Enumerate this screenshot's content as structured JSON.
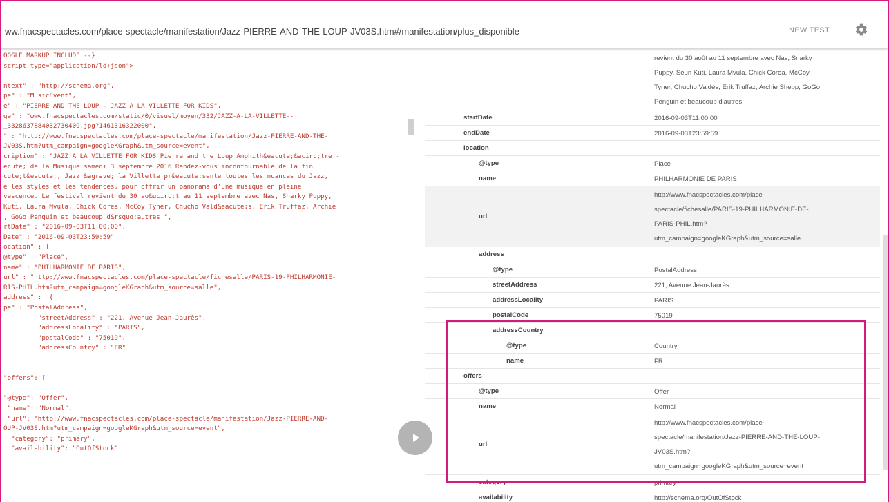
{
  "header": {
    "url": "ww.fnacspectacles.com/place-spectacle/manifestation/Jazz-PIERRE-AND-THE-LOUP-JV03S.htm#/manifestation/plus_disponible",
    "new_test_label": "NEW TEST",
    "settings_icon": "gear-icon"
  },
  "code_lines": [
    "OOGLE MARKUP INCLUDE --}",
    "script type=\"application/ld+json\">",
    "",
    "ntext\" : \"http://schema.org\",",
    "pe\" : \"MusicEvent\",",
    "e\" : \"PIERRE AND THE LOUP - JAZZ A LA VILLETTE FOR KIDS\",",
    "ge\" : \"www.fnacspectacles.com/static/0/visuel/moyen/332/JAZZ-A-LA-VILLETTE--",
    "_3328637884032730409.jpg?1461316322000\",",
    "\" : \"http://www.fnacspectacles.com/place-spectacle/manifestation/Jazz-PIERRE-AND-THE-",
    "JV03S.htm?utm_campaign=googleKGraph&utm_source=event\",",
    "cription\" : \"JAZZ A LA VILLETTE FOR KIDS Pierre and the Loup Amphith&eacute;&acirc;tre -",
    "ecute; de la Musique samedi 3 septembre 2016 Rendez-vous incontournable de la fin",
    "cute;t&eacute;, Jazz &agrave; la Villette pr&eacute;sente toutes les nuances du Jazz,",
    "e les styles et les tendences, pour offrir un panorama d'une musique en pleine",
    "vescence. Le festival revient du 30 ao&ucirc;t au 11 septembre avec Nas, Snarky Puppy,",
    "Kuti, Laura Mvula, Chick Corea, McCoy Tyner, Chucho Vald&eacute;s, Erik Truffaz, Archie",
    ", GoGo Penguin et beaucoup d&rsquo;autres.\",",
    "rtDate\" : \"2016-09-03T11:00:00\",",
    "Date\" : \"2016-09-03T23:59:59\"",
    "ocation\" : {",
    "@type\" : \"Place\",",
    "name\" : \"PHILHARMONIE DE PARIS\",",
    "url\" : \"http://www.fnacspectacles.com/place-spectacle/fichesalle/PARIS-19-PHILHARMONIE-",
    "RIS-PHIL.htm?utm_campaign=googleKGraph&utm_source=salle\",",
    "address\" :  {",
    "pe\" : \"PostalAddress\",",
    "         \"streetAddress\" : \"221, Avenue Jean-Jaurès\",",
    "         \"addressLocality\" : \"PARIS\",",
    "         \"postalCode\" : \"75019\",",
    "         \"addressCountry\" : \"FR\"",
    "",
    "",
    "\"offers\": [",
    "",
    "\"@type\": \"Offer\",",
    " \"name\": \"Normal\",",
    " \"url\": \"http://www.fnacspectacles.com/place-spectacle/manifestation/Jazz-PIERRE-AND-",
    "OUP-JV03S.htm?utm_campaign=googleKGraph&utm_source=event\",",
    "  \"category\": \"primary\",",
    "  \"availability\": \"OutOfStock\""
  ],
  "result_rows": [
    {
      "key": "",
      "value": [
        "revient du 30 août au 11 septembre avec Nas, Snarky",
        "Puppy, Seun Kuti, Laura Mvula, Chick Corea, McCoy",
        "Tyner, Chucho Valdés, Erik Truffaz, Archie Shepp, GoGo",
        "Penguin et beaucoup d'autres."
      ]
    },
    {
      "key": "startDate",
      "value": [
        "2016-09-03T11:00:00"
      ]
    },
    {
      "key": "endDate",
      "value": [
        "2016-09-03T23:59:59"
      ]
    },
    {
      "key": "location",
      "value": []
    },
    {
      "key": "@type",
      "value": [
        "Place"
      ]
    },
    {
      "key": "name",
      "value": [
        "PHILHARMONIE DE PARIS"
      ]
    },
    {
      "key": "url",
      "value": [
        "http://www.fnacspectacles.com/place-",
        "spectacle/fichesalle/PARIS-19-PHILHARMONIE-DE-",
        "PARIS-PHIL.htm?",
        "utm_campaign=googleKGraph&utm_source=salle"
      ]
    },
    {
      "key": "address",
      "value": []
    },
    {
      "key": "@type",
      "value": [
        "PostalAddress"
      ]
    },
    {
      "key": "streetAddress",
      "value": [
        "221, Avenue Jean-Jaurès"
      ]
    },
    {
      "key": "addressLocality",
      "value": [
        "PARIS"
      ]
    },
    {
      "key": "postalCode",
      "value": [
        "75019"
      ]
    },
    {
      "key": "addressCountry",
      "value": []
    },
    {
      "key": "@type",
      "value": [
        "Country"
      ]
    },
    {
      "key": "name",
      "value": [
        "FR"
      ]
    },
    {
      "key": "offers",
      "value": []
    },
    {
      "key": "@type",
      "value": [
        "Offer"
      ]
    },
    {
      "key": "name",
      "value": [
        "Normal"
      ]
    },
    {
      "key": "url",
      "value": [
        "http://www.fnacspectacles.com/place-",
        "spectacle/manifestation/Jazz-PIERRE-AND-THE-LOUP-",
        "JV03S.htm?",
        "utm_campaign=googleKGraph&utm_source=event"
      ]
    },
    {
      "key": "category",
      "value": [
        "primary"
      ]
    },
    {
      "key": "availability",
      "value": [
        "http://schema.org/OutOfStock"
      ]
    }
  ],
  "colors": {
    "highlight": "#d6197f",
    "code_text": "#c0392b"
  }
}
